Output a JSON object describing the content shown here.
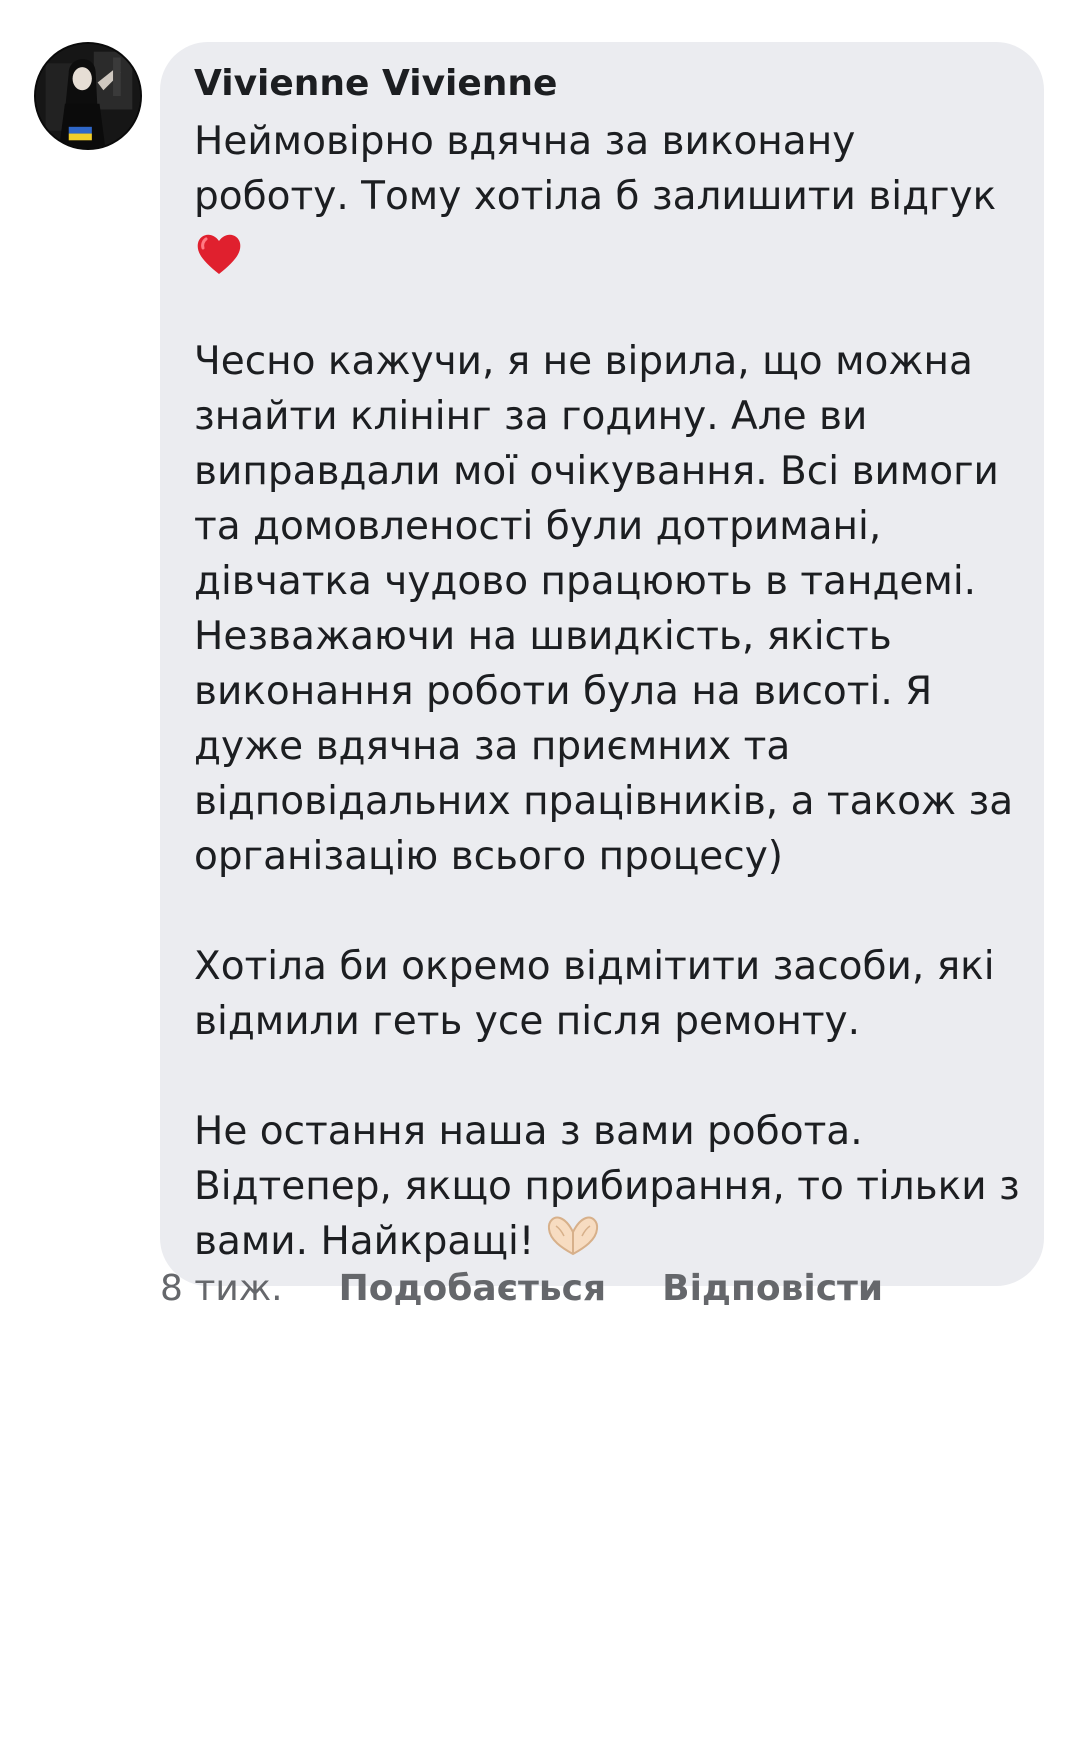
{
  "comment": {
    "author": "Vivienne Vivienne",
    "avatar_icon": "profile-photo-icon",
    "paragraphs": [
      {
        "lines": [
          "Неймовірно вдячна за виконану",
          "роботу. Тому хотіла б залишити відгук"
        ],
        "trailing_emoji": "red-heart-icon"
      },
      {
        "lines": [
          "Чесно кажучи, я не вірила, що можна",
          "знайти клінінг за годину. Але ви",
          "виправдали мої очікування. Всі вимоги",
          "та домовленості були дотримані,",
          "дівчатка чудово працюють в тандемі.",
          "Незважаючи на швидкість, якість",
          "виконання роботи була на висоті. Я",
          "дуже вдячна за приємних та",
          "відповідальних працівників, а також за",
          "організацію всього процесу)"
        ]
      },
      {
        "lines": [
          "Хотіла би окремо відмітити засоби, які",
          "відмили геть усе після ремонту."
        ]
      },
      {
        "lines": [
          "Не остання наша з вами робота.",
          "Відтепер, якщо прибирання, то тільки з",
          "вами. Найкращі!"
        ],
        "trailing_emoji": "heart-hands-icon"
      }
    ],
    "bubble_color": "#ebecf0"
  },
  "actions": {
    "timestamp": "8 тиж.",
    "like_label": "Подобається",
    "reply_label": "Відповісти",
    "text_color": "#65676b"
  }
}
